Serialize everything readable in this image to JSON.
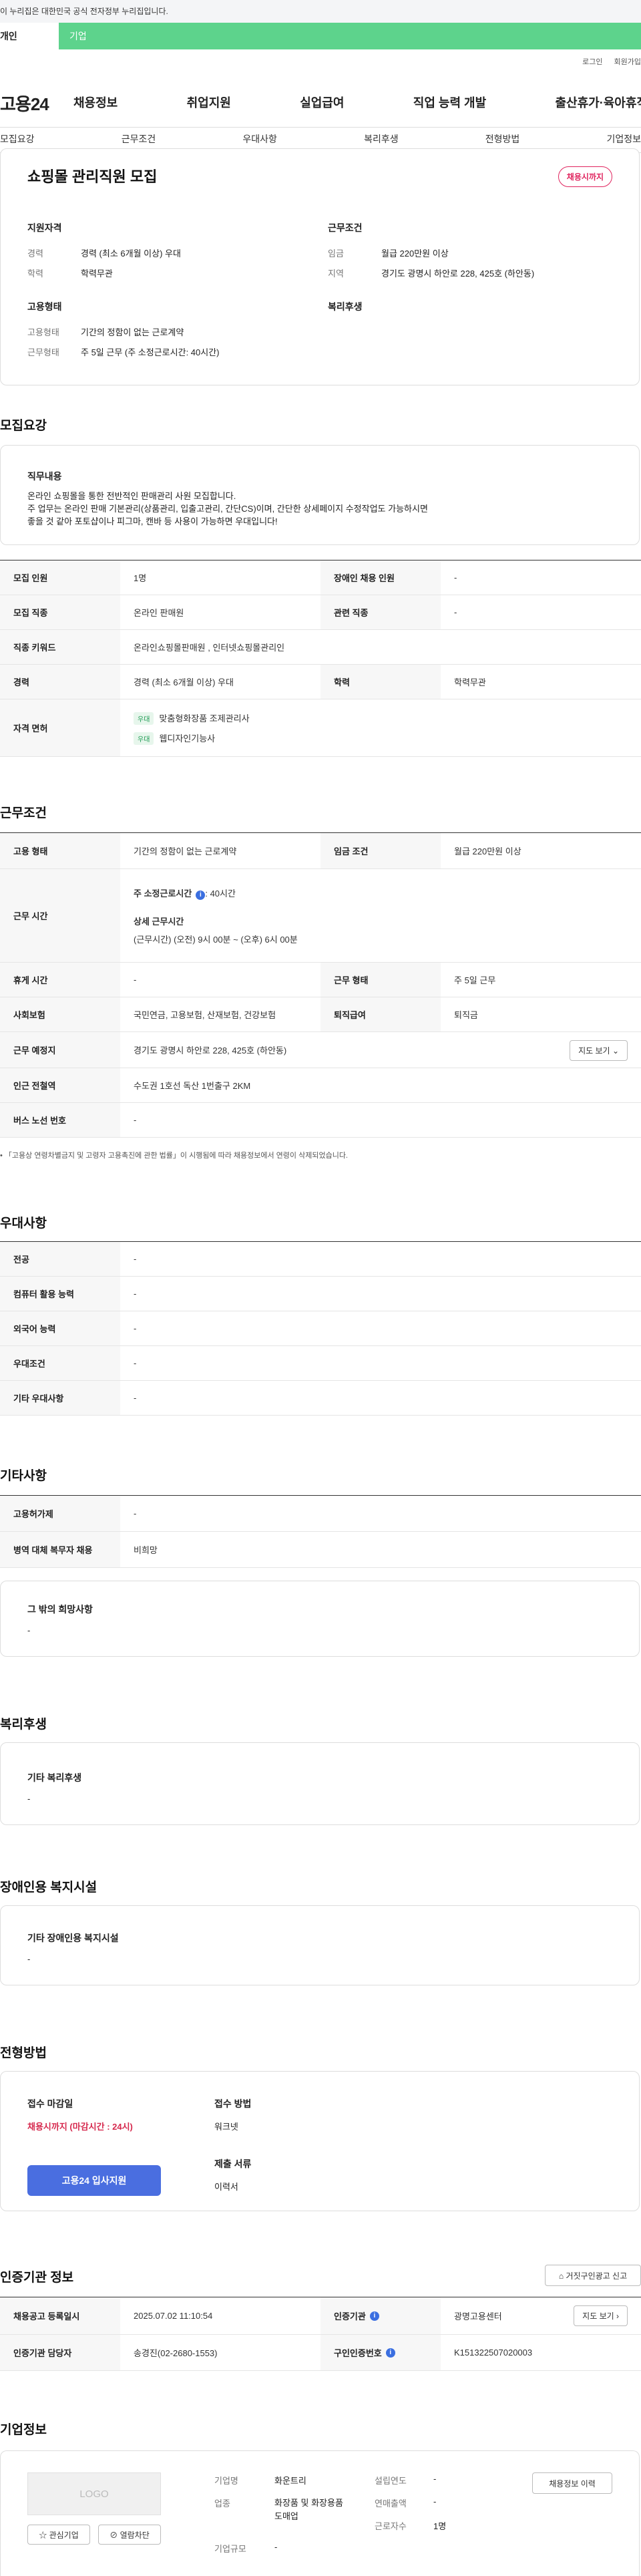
{
  "gov_banner": "이 누리집은 대한민국 공식 전자정부 누리집입니다.",
  "tabs": {
    "person": "개인",
    "corp": "기업"
  },
  "util": {
    "login": "로그인",
    "join": "회원가입"
  },
  "logo": "고용24",
  "gnb": [
    "채용정보",
    "취업지원",
    "실업급여",
    "직업 능력 개발",
    "출산휴가·육아휴직"
  ],
  "subnav": [
    "모집요강",
    "근무조건",
    "우대사항",
    "복리후생",
    "전형방법",
    "기업정보"
  ],
  "job": {
    "title": "쇼핑몰 관리직원 모집",
    "deadline_badge": "채용시까지",
    "qual_title": "지원자격",
    "qual": [
      {
        "k": "경력",
        "v": "경력 (최소 6개월 이상) 우대"
      },
      {
        "k": "학력",
        "v": "학력무관"
      }
    ],
    "cond_title": "근무조건",
    "cond": [
      {
        "k": "임금",
        "v": "월급 220만원 이상"
      },
      {
        "k": "지역",
        "v": "경기도 광명시 하안로 228, 425호 (하안동)"
      }
    ],
    "emp_title": "고용형태",
    "emp": [
      {
        "k": "고용형태",
        "v": "기간의 정함이 없는 근로계약"
      },
      {
        "k": "근무형태",
        "v": "주 5일 근무 (주 소정근로시간: 40시간)"
      }
    ],
    "welfare_title": "복리후생"
  },
  "recruit": {
    "section": "모집요강",
    "duty_title": "직무내용",
    "duty_lines": [
      "온라인 쇼핑몰을 통한 전반적인 판매관리 사원 모집합니다.",
      "주 업무는 온라인 판매 기본관리(상품관리, 입출고관리, 간단CS)이며, 간단한 상세페이지 수정작업도 가능하시면",
      "좋을 것 같아 포토샵이나 피그마, 캔바 등 사용이 가능하면 우대입니다!"
    ],
    "rows": {
      "count_label": "모집 인원",
      "count": "1명",
      "disabled_label": "장애인 채용 인원",
      "disabled": "-",
      "job_label": "모집 직종",
      "job": "온라인 판매원",
      "related_label": "관련 직종",
      "related": "-",
      "keyword_label": "직종 키워드",
      "keyword": "온라인쇼핑몰판매원 , 인터넷쇼핑몰관리인",
      "career_label": "경력",
      "career": "경력 (최소 6개월 이상) 우대",
      "edu_label": "학력",
      "edu": "학력무관",
      "license_label": "자격 면허",
      "licenses": [
        {
          "tag": "우대",
          "name": "맞춤형화장품 조제관리사"
        },
        {
          "tag": "우대",
          "name": "웹디자인기능사"
        }
      ]
    }
  },
  "work": {
    "section": "근무조건",
    "emp_label": "고용 형태",
    "emp": "기간의 정함이 없는 근로계약",
    "wage_label": "임금 조건",
    "wage": "월급 220만원 이상",
    "hours_label": "근무 시간",
    "hours_main": "주 소정근로시간",
    "hours_main_val": ": 40시간",
    "hours_detail_title": "상세 근무시간",
    "hours_detail": "(근무시간) (오전) 9시 00분 ~ (오후) 6시 00분",
    "rest_label": "휴게 시간",
    "rest": "-",
    "type_label": "근무 형태",
    "type": "주 5일 근무",
    "insurance_label": "사회보험",
    "insurance": "국민연금, 고용보험, 산재보험, 건강보험",
    "severance_label": "퇴직급여",
    "severance": "퇴직금",
    "place_label": "근무 예정지",
    "place": "경기도 광명시 하안로 228, 425호 (하안동)",
    "map_btn": "지도 보기",
    "subway_label": "인근 전철역",
    "subway": "수도권 1호선 독산 1번출구 2KM",
    "bus_label": "버스 노선 번호",
    "bus": "-",
    "note": "「고용상 연령차별금지 및 고령자 고용촉진에 관한 법률」이 시행됨에 따라 채용정보에서 연령이 삭제되었습니다."
  },
  "pref": {
    "section": "우대사항",
    "rows": [
      {
        "k": "전공",
        "v": "-"
      },
      {
        "k": "컴퓨터 활용 능력",
        "v": "-"
      },
      {
        "k": "외국어 능력",
        "v": "-"
      },
      {
        "k": "우대조건",
        "v": "-"
      },
      {
        "k": "기타 우대사항",
        "v": "-"
      }
    ]
  },
  "etc": {
    "section": "기타사항",
    "rows": [
      {
        "k": "고용허가제",
        "v": "-"
      },
      {
        "k": "병역 대체 복무자 채용",
        "v": "비희망"
      }
    ],
    "other_title": "그 밖의 희망사항",
    "other_val": "-"
  },
  "welfare": {
    "section": "복리후생",
    "title": "기타 복리후생",
    "val": "-"
  },
  "facility": {
    "section": "장애인용 복지시설",
    "title": "기타 장애인용 복지시설",
    "val": "-"
  },
  "apply": {
    "section": "전형방법",
    "deadline_label": "접수 마감일",
    "deadline": "채용시까지 (마감시간 : 24시)",
    "method_label": "접수 방법",
    "method": "워크넷",
    "docs_label": "제출 서류",
    "docs": "이력서",
    "apply_btn": "고용24 입사지원"
  },
  "cert": {
    "section": "인증기관 정보",
    "report_btn": "거짓구인광고 신고",
    "reg_label": "채용공고 등록일시",
    "reg": "2025.07.02 11:10:54",
    "org_label": "인증기관",
    "org": "광명고용센터",
    "map_btn": "지도 보기",
    "manager_label": "인증기관 담당자",
    "manager": "송경진(02-2680-1553)",
    "num_label": "구인인증번호",
    "num": "K151322507020003"
  },
  "company": {
    "section": "기업정보",
    "logo_text": "LOGO",
    "fav_btn": "관심기업",
    "block_btn": "열람차단",
    "history_btn": "채용정보 이력",
    "name_label": "기업명",
    "name": "화운트리",
    "industry_label": "업종",
    "industry": "화장품 및 화장용품 도매업",
    "size_label": "기업규모",
    "size": "-",
    "founded_label": "설립연도",
    "founded": "-",
    "sales_label": "연매출액",
    "sales": "-",
    "employees_label": "근로자수",
    "employees": "1명"
  },
  "colors": {
    "accent_green": "#5dd38c",
    "badge_pink": "#e0245e",
    "apply_blue": "#4a6ee0",
    "deadline_red": "#d6294e"
  }
}
